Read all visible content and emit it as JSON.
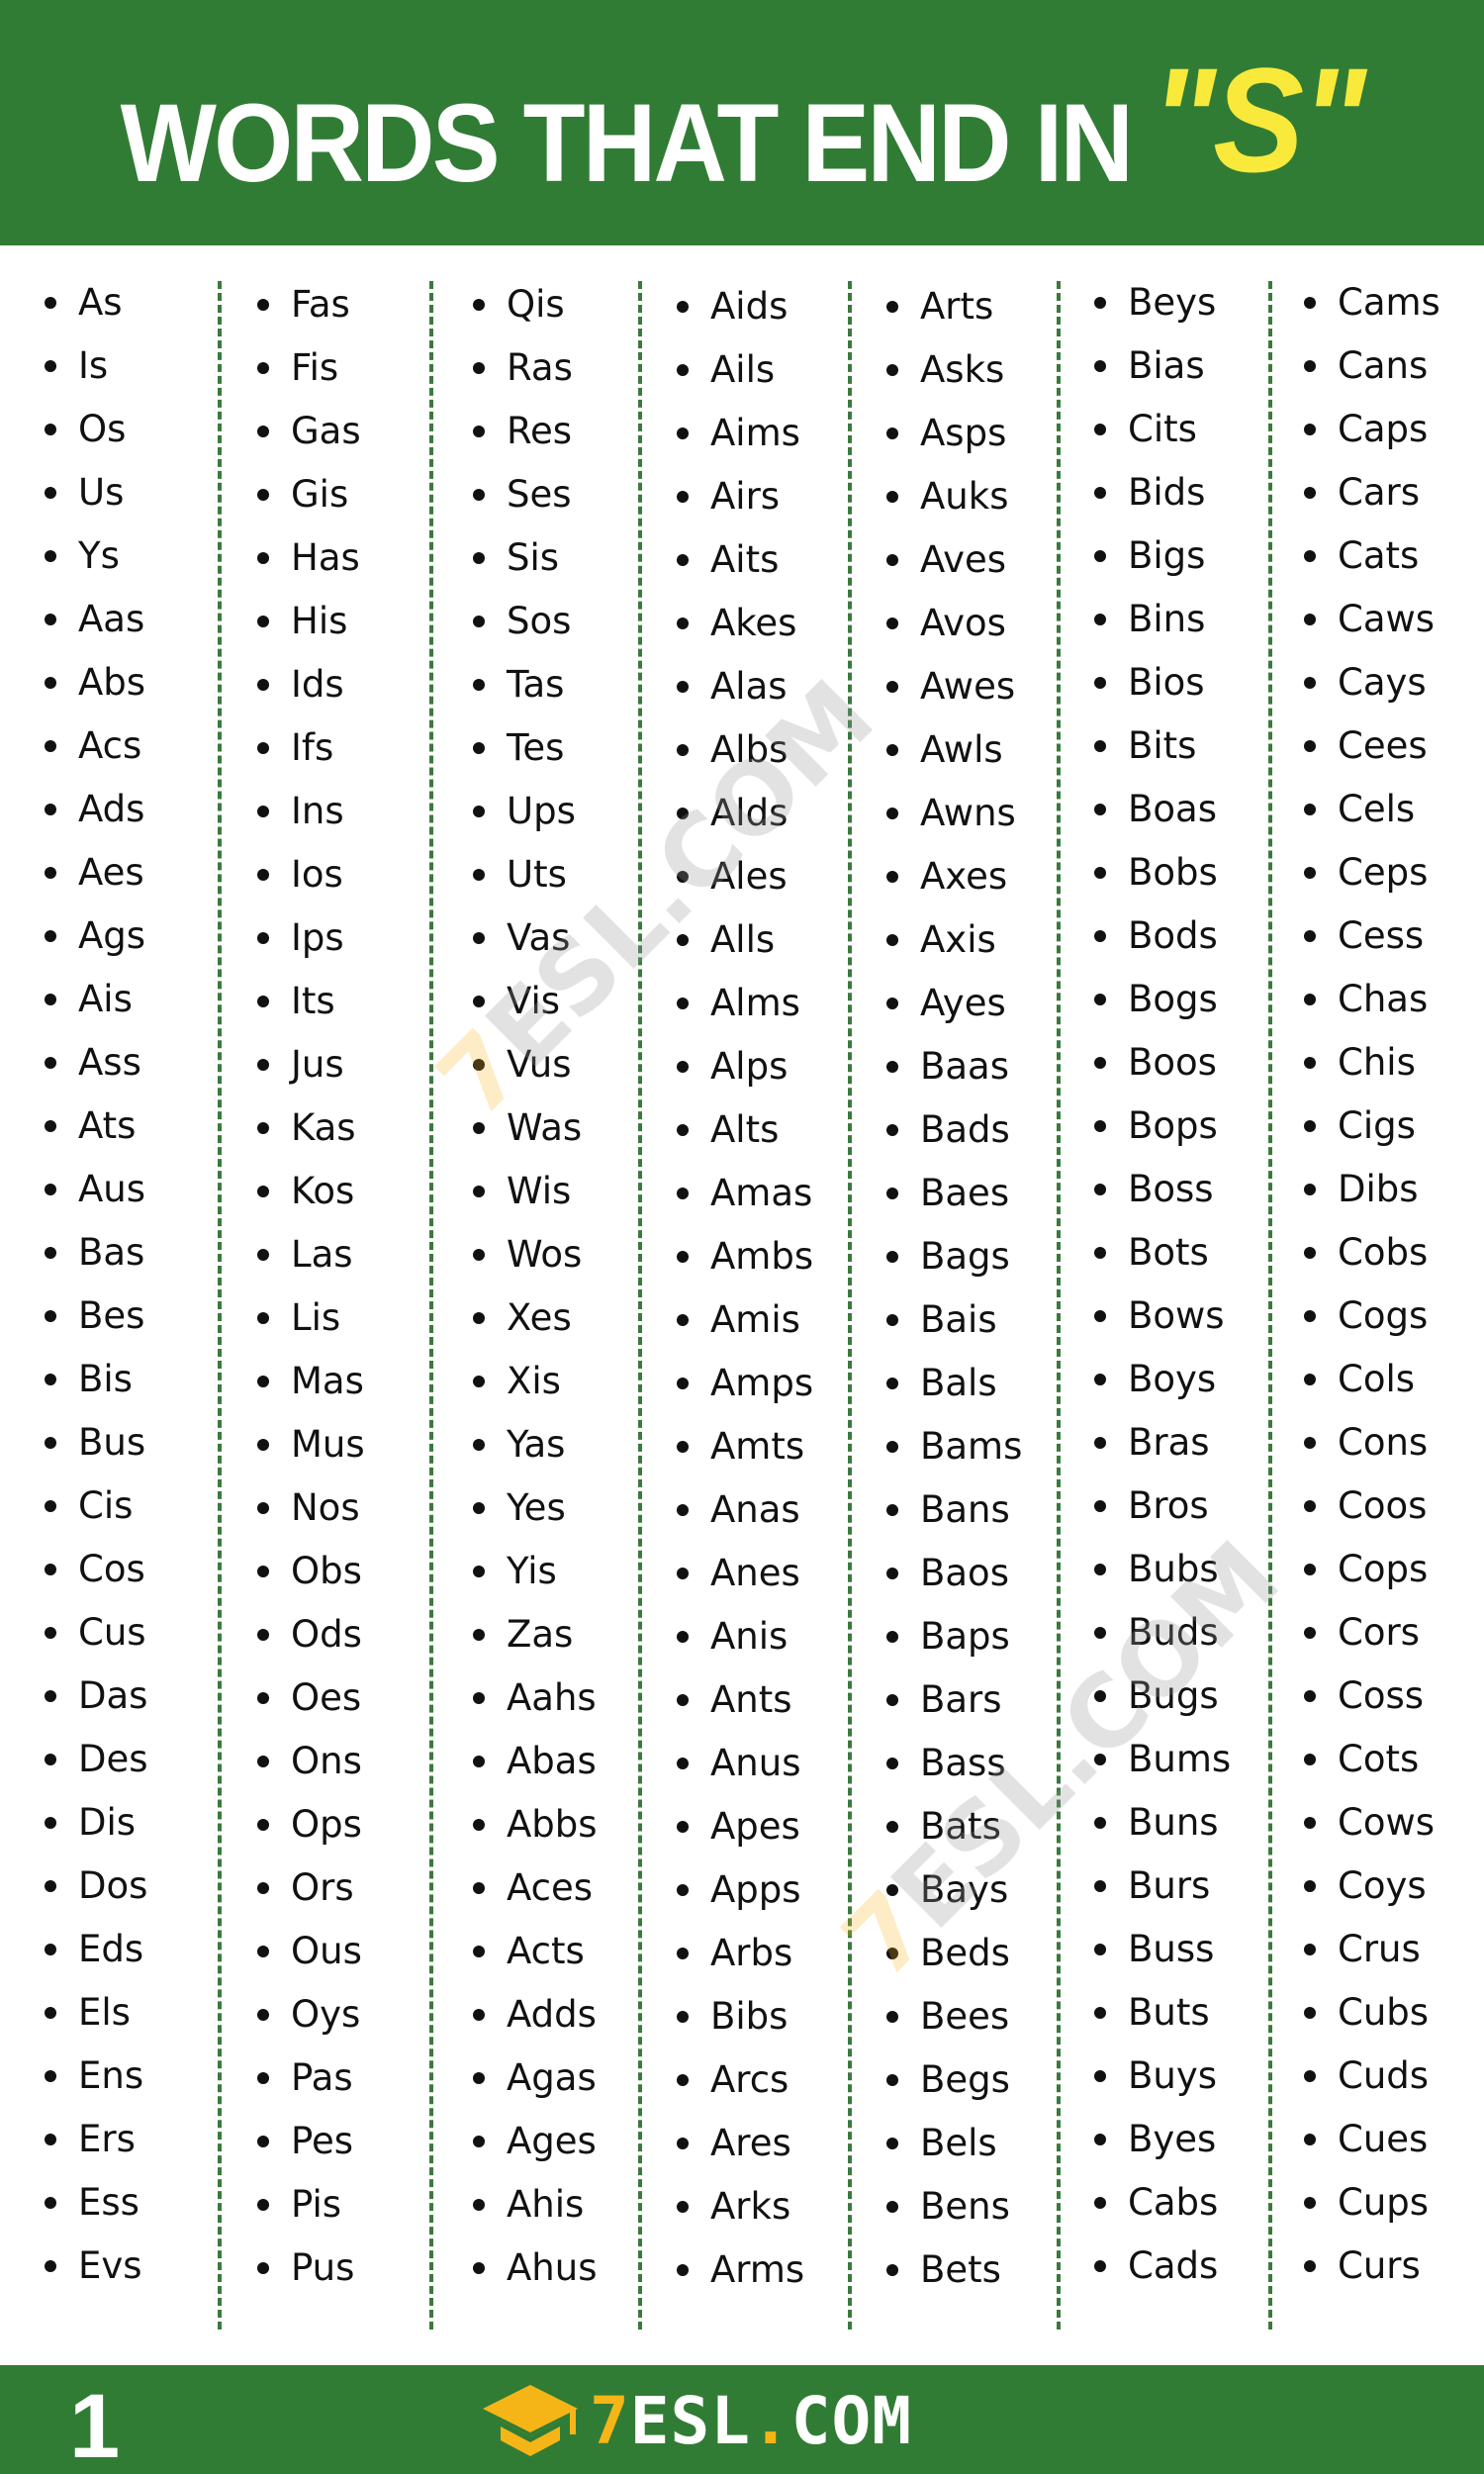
{
  "header": {
    "title_main": "WORDS THAT END IN",
    "title_highlight": "\"S\""
  },
  "colors": {
    "brand_green": "#317c35",
    "highlight_yellow": "#f8e93b",
    "logo_orange": "#f6b517"
  },
  "columns": [
    {
      "words": [
        "As",
        "Is",
        "Os",
        "Us",
        "Ys",
        "Aas",
        "Abs",
        "Acs",
        "Ads",
        "Aes",
        "Ags",
        "Ais",
        "Ass",
        "Ats",
        "Aus",
        "Bas",
        "Bes",
        "Bis",
        "Bus",
        "Cis",
        "Cos",
        "Cus",
        "Das",
        "Des",
        "Dis",
        "Dos",
        "Eds",
        "Els",
        "Ens",
        "Ers",
        "Ess",
        "Evs"
      ]
    },
    {
      "words": [
        "Fas",
        "Fis",
        "Gas",
        "Gis",
        "Has",
        "His",
        "Ids",
        "Ifs",
        "Ins",
        "Ios",
        "Ips",
        "Its",
        "Jus",
        "Kas",
        "Kos",
        "Las",
        "Lis",
        "Mas",
        "Mus",
        "Nos",
        "Obs",
        "Ods",
        "Oes",
        "Ons",
        "Ops",
        "Ors",
        "Ous",
        "Oys",
        "Pas",
        "Pes",
        "Pis",
        "Pus"
      ]
    },
    {
      "words": [
        "Qis",
        "Ras",
        "Res",
        "Ses",
        "Sis",
        "Sos",
        "Tas",
        "Tes",
        "Ups",
        "Uts",
        "Vas",
        "Vis",
        "Vus",
        "Was",
        "Wis",
        "Wos",
        "Xes",
        "Xis",
        "Yas",
        "Yes",
        "Yis",
        "Zas",
        "Aahs",
        "Abas",
        "Abbs",
        "Aces",
        "Acts",
        "Adds",
        "Agas",
        "Ages",
        "Ahis",
        "Ahus"
      ]
    },
    {
      "words": [
        "Aids",
        "Ails",
        "Aims",
        "Airs",
        "Aits",
        "Akes",
        "Alas",
        "Albs",
        "Alds",
        "Ales",
        "Alls",
        "Alms",
        "Alps",
        "Alts",
        "Amas",
        "Ambs",
        "Amis",
        "Amps",
        "Amts",
        "Anas",
        "Anes",
        "Anis",
        "Ants",
        "Anus",
        "Apes",
        "Apps",
        "Arbs",
        "Bibs",
        "Arcs",
        "Ares",
        "Arks",
        "Arms"
      ]
    },
    {
      "words": [
        "Arts",
        "Asks",
        "Asps",
        "Auks",
        "Aves",
        "Avos",
        "Awes",
        "Awls",
        "Awns",
        "Axes",
        "Axis",
        "Ayes",
        "Baas",
        "Bads",
        "Baes",
        "Bags",
        "Bais",
        "Bals",
        "Bams",
        "Bans",
        "Baos",
        "Baps",
        "Bars",
        "Bass",
        "Bats",
        "Bays",
        "Beds",
        "Bees",
        "Begs",
        "Bels",
        "Bens",
        "Bets"
      ]
    },
    {
      "words": [
        "Beys",
        "Bias",
        "Cits",
        "Bids",
        "Bigs",
        "Bins",
        "Bios",
        "Bits",
        "Boas",
        "Bobs",
        "Bods",
        "Bogs",
        "Boos",
        "Bops",
        "Boss",
        "Bots",
        "Bows",
        "Boys",
        "Bras",
        "Bros",
        "Bubs",
        "Buds",
        "Bugs",
        "Bums",
        "Buns",
        "Burs",
        "Buss",
        "Buts",
        "Buys",
        "Byes",
        "Cabs",
        "Cads"
      ]
    },
    {
      "words": [
        "Cams",
        "Cans",
        "Caps",
        "Cars",
        "Cats",
        "Caws",
        "Cays",
        "Cees",
        "Cels",
        "Ceps",
        "Cess",
        "Chas",
        "Chis",
        "Cigs",
        "Dibs",
        "Cobs",
        "Cogs",
        "Cols",
        "Cons",
        "Coos",
        "Cops",
        "Cors",
        "Coss",
        "Cots",
        "Cows",
        "Coys",
        "Crus",
        "Cubs",
        "Cuds",
        "Cues",
        "Cups",
        "Curs"
      ]
    }
  ],
  "watermark": {
    "seven": "7",
    "rest": "ESL.COM"
  },
  "footer": {
    "page_number": "1",
    "logo_seven": "7",
    "logo_esl": "ESL",
    "logo_dot": ".",
    "logo_com": "COM",
    "logo_icon": "graduation-cap-icon"
  }
}
